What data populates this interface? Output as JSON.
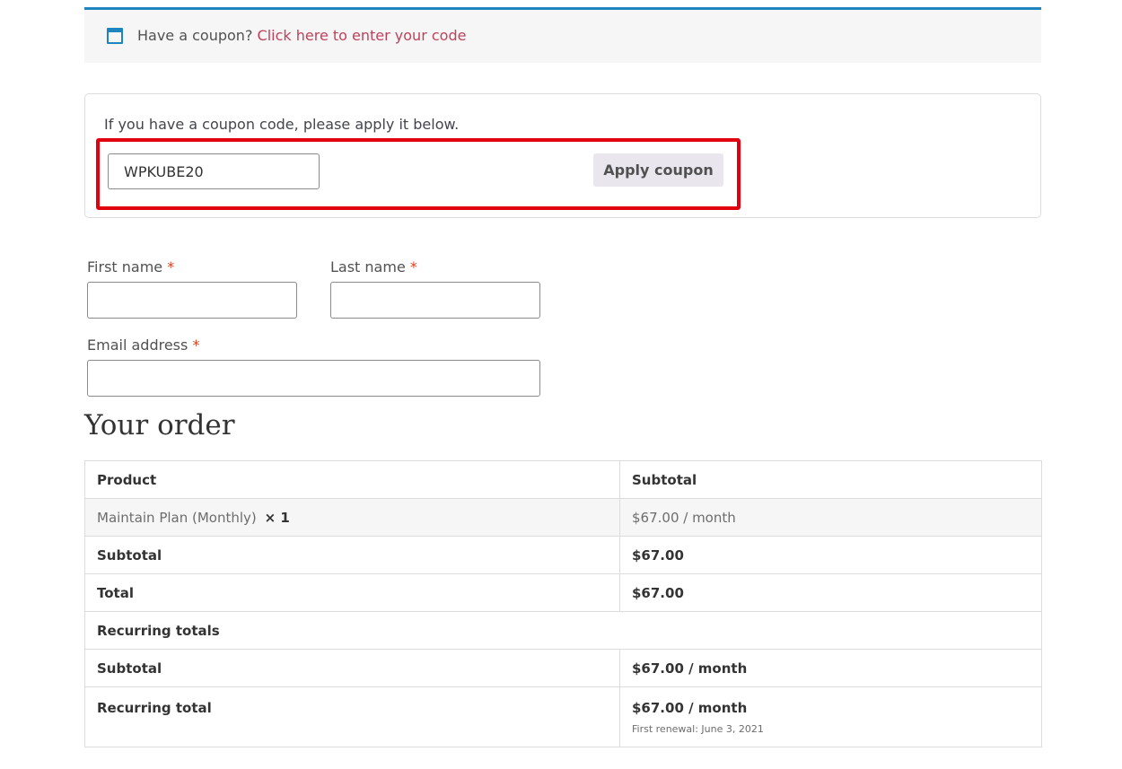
{
  "coupon_notice": {
    "prefix": "Have a coupon?",
    "link": "Click here to enter your code"
  },
  "coupon_form": {
    "intro": "If you have a coupon code, please apply it below.",
    "code_value": "WPKUBE20",
    "apply_label": "Apply coupon"
  },
  "billing": {
    "first_name_label": "First name",
    "last_name_label": "Last name",
    "email_label": "Email address",
    "required_mark": "*"
  },
  "order": {
    "heading": "Your order",
    "headers": {
      "product": "Product",
      "subtotal": "Subtotal"
    },
    "item": {
      "name": "Maintain Plan (Monthly)",
      "qty": "× 1",
      "price": "$67.00 / month"
    },
    "subtotal": {
      "label": "Subtotal",
      "value": "$67.00"
    },
    "total": {
      "label": "Total",
      "value": "$67.00"
    },
    "recurring_heading": "Recurring totals",
    "recurring_subtotal": {
      "label": "Subtotal",
      "value": "$67.00 / month"
    },
    "recurring_total": {
      "label": "Recurring total",
      "value": "$67.00 / month",
      "renewal": "First renewal: June 3, 2021"
    }
  },
  "colors": {
    "accent": "#1e85be",
    "link": "#c0415b",
    "highlight": "#e2000f",
    "required": "#e2401c"
  },
  "icons": {
    "notice": "window-icon"
  }
}
